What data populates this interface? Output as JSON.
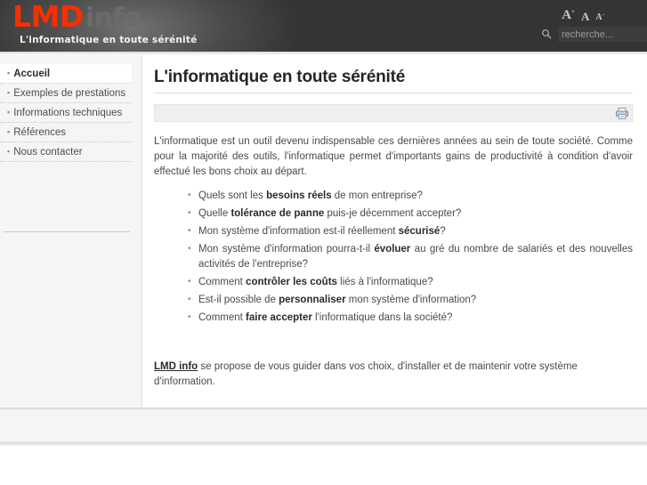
{
  "header": {
    "logo_primary": "LMD",
    "logo_secondary": "info",
    "tagline": "L'informatique en toute sérénité",
    "font_size_controls": {
      "increase": "A",
      "increase_marker": "+",
      "reset": "A",
      "decrease": "A",
      "decrease_marker": "-"
    },
    "search": {
      "placeholder": "recherche...",
      "value": "",
      "icon": "search-icon"
    },
    "background_color": "#343434",
    "logo_color": "#f52f00"
  },
  "sidebar": {
    "items": [
      {
        "label": "Accueil",
        "active": true
      },
      {
        "label": "Exemples de prestations",
        "active": false
      },
      {
        "label": "Informations techniques",
        "active": false
      },
      {
        "label": "Références",
        "active": false
      },
      {
        "label": "Nous contacter",
        "active": false
      }
    ]
  },
  "main": {
    "title": "L'informatique en toute sérénité",
    "toolbar": {
      "print_icon": "printer-icon"
    },
    "intro": "L'informatique est un outil devenu indispensable ces dernières années au sein de toute société. Comme pour la majorité des outils, l'informatique permet d'importants gains de productivité à condition d'avoir effectué les bons choix au départ.",
    "questions": [
      {
        "before": "Quels sont les ",
        "bold": "besoins réels",
        "after": " de  mon entreprise?"
      },
      {
        "before": "Quelle ",
        "bold": "tolérance de panne",
        "after": " puis-je décemment accepter?"
      },
      {
        "before": "Mon système d'information est-il réellement ",
        "bold": "sécurisé",
        "after": "?"
      },
      {
        "before": "Mon système d'information pourra-t-il ",
        "bold": "évoluer",
        "after": " au gré du nombre de salariés et des nouvelles activités de l'entreprise?"
      },
      {
        "before": "Comment ",
        "bold": "contrôler les coûts",
        "after": " liés à l'informatique?"
      },
      {
        "before": "Est-il possible de ",
        "bold": "personnaliser",
        "after": " mon système d'information?"
      },
      {
        "before": "Comment ",
        "bold": "faire accepter",
        "after": " l'informatique dans la société?"
      }
    ],
    "closing": {
      "link": "LMD info",
      "text": " se propose de vous guider dans vos choix, d'installer et de maintenir votre système d'information."
    }
  },
  "footer": {
    "text": ""
  }
}
